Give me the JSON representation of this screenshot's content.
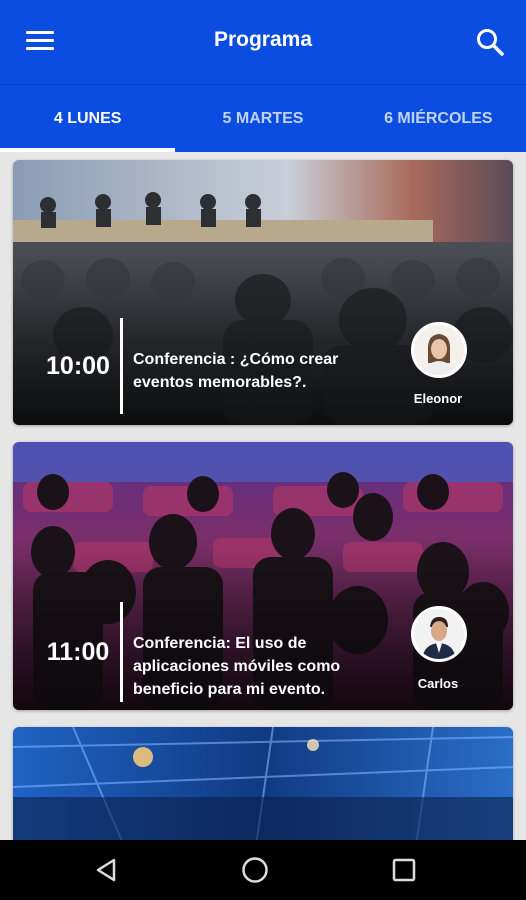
{
  "app_bar": {
    "title": "Programa",
    "menu_icon": "menu-icon",
    "search_icon": "search-icon"
  },
  "tabs": [
    {
      "label": "4 LUNES",
      "active": true
    },
    {
      "label": "5 MARTES",
      "active": false
    },
    {
      "label": "6 MIÉRCOLES",
      "active": false
    }
  ],
  "sessions": [
    {
      "time": "10:00",
      "title": "Conferencia : ¿Cómo crear eventos memorables?.",
      "speaker": "Eleonor"
    },
    {
      "time": "11:00",
      "title": "Conferencia: El uso de aplicaciones móviles como beneficio para mi evento.",
      "speaker": "Carlos"
    }
  ],
  "colors": {
    "primary": "#0a4de0",
    "tab_indicator": "#ffffff",
    "background": "#e6e6e6"
  },
  "nav": {
    "back_icon": "back-icon",
    "home_icon": "home-icon",
    "recents_icon": "recents-icon"
  }
}
